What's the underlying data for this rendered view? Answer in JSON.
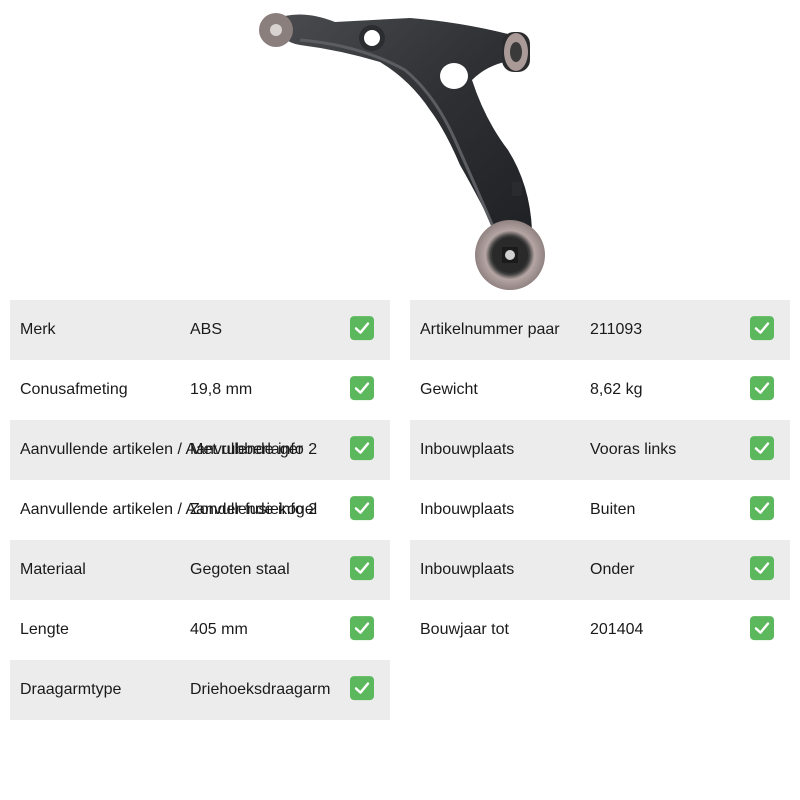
{
  "product": {
    "image_icon": "control-arm-image"
  },
  "colors": {
    "row_shade": "#ececec",
    "check_green": "#5cb85c"
  },
  "left_specs": [
    {
      "label": "Merk",
      "value": "ABS",
      "shaded": true
    },
    {
      "label": "Conusafmeting",
      "value": "19,8 mm",
      "shaded": false
    },
    {
      "label": "Aanvullende artikelen / Aanvullende info 2",
      "value": "Met rubberlager",
      "shaded": true
    },
    {
      "label": "Aanvullende artikelen / Aanvullende info 2",
      "value": "Zonder fusiekogel",
      "shaded": false
    },
    {
      "label": "Materiaal",
      "value": "Gegoten staal",
      "shaded": true
    },
    {
      "label": "Lengte",
      "value": "405 mm",
      "shaded": false
    },
    {
      "label": "Draagarmtype",
      "value": "Driehoeksdraagarm",
      "shaded": true
    }
  ],
  "right_specs": [
    {
      "label": "Artikelnummer paar",
      "value": "211093",
      "shaded": true
    },
    {
      "label": "Gewicht",
      "value": "8,62 kg",
      "shaded": false
    },
    {
      "label": "Inbouwplaats",
      "value": "Vooras links",
      "shaded": true
    },
    {
      "label": "Inbouwplaats",
      "value": "Buiten",
      "shaded": false
    },
    {
      "label": "Inbouwplaats",
      "value": "Onder",
      "shaded": true
    },
    {
      "label": "Bouwjaar tot",
      "value": "201404",
      "shaded": false
    }
  ],
  "check_icon": "check-mark-icon"
}
